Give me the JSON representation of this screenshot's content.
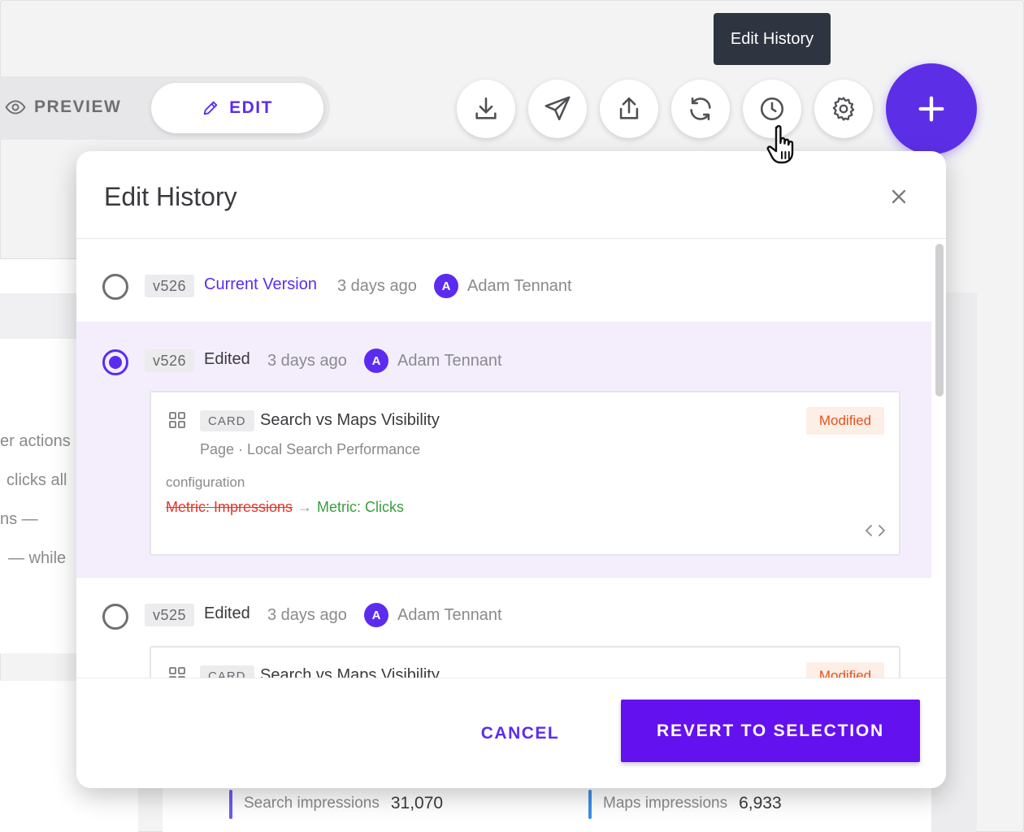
{
  "mode_toggle": {
    "preview_label": "PREVIEW",
    "edit_label": "EDIT"
  },
  "toolbar": {
    "buttons": [
      "download-icon",
      "send-icon",
      "share-icon",
      "refresh-icon",
      "history-icon",
      "gear-icon"
    ],
    "tooltip": "Edit History",
    "fab_icon": "plus-icon"
  },
  "background": {
    "fragments": [
      "er actions",
      "clicks all",
      "ns —",
      "— while"
    ],
    "stats": [
      {
        "label": "Search impressions",
        "value": "31,070",
        "color": "#6b5cf0"
      },
      {
        "label": "Maps impressions",
        "value": "6,933",
        "color": "#3a8fe6"
      }
    ]
  },
  "modal": {
    "title": "Edit History",
    "entries": [
      {
        "version": "v526",
        "status": "Current Version",
        "when": "3 days ago",
        "avatar": "A",
        "author": "Adam Tennant",
        "selected": false
      },
      {
        "version": "v526",
        "status": "Edited",
        "when": "3 days ago",
        "avatar": "A",
        "author": "Adam Tennant",
        "selected": true,
        "change": {
          "type": "CARD",
          "title": "Search vs Maps Visibility",
          "badge": "Modified",
          "page": "Page · Local Search Performance",
          "field": "configuration",
          "old": "Metric: Impressions",
          "arrow": "→",
          "new": "Metric: Clicks"
        }
      },
      {
        "version": "v525",
        "status": "Edited",
        "when": "3 days ago",
        "avatar": "A",
        "author": "Adam Tennant",
        "selected": false,
        "change": {
          "type": "CARD",
          "title": "Search vs Maps Visibility",
          "badge": "Modified"
        }
      }
    ],
    "cancel_label": "CANCEL",
    "revert_label": "REVERT TO SELECTION"
  },
  "colors": {
    "accent": "#5b2cf0",
    "primary_button": "#6411f0",
    "modified": "#e5531f",
    "removed": "#e5352a",
    "added": "#3a9d3e"
  }
}
